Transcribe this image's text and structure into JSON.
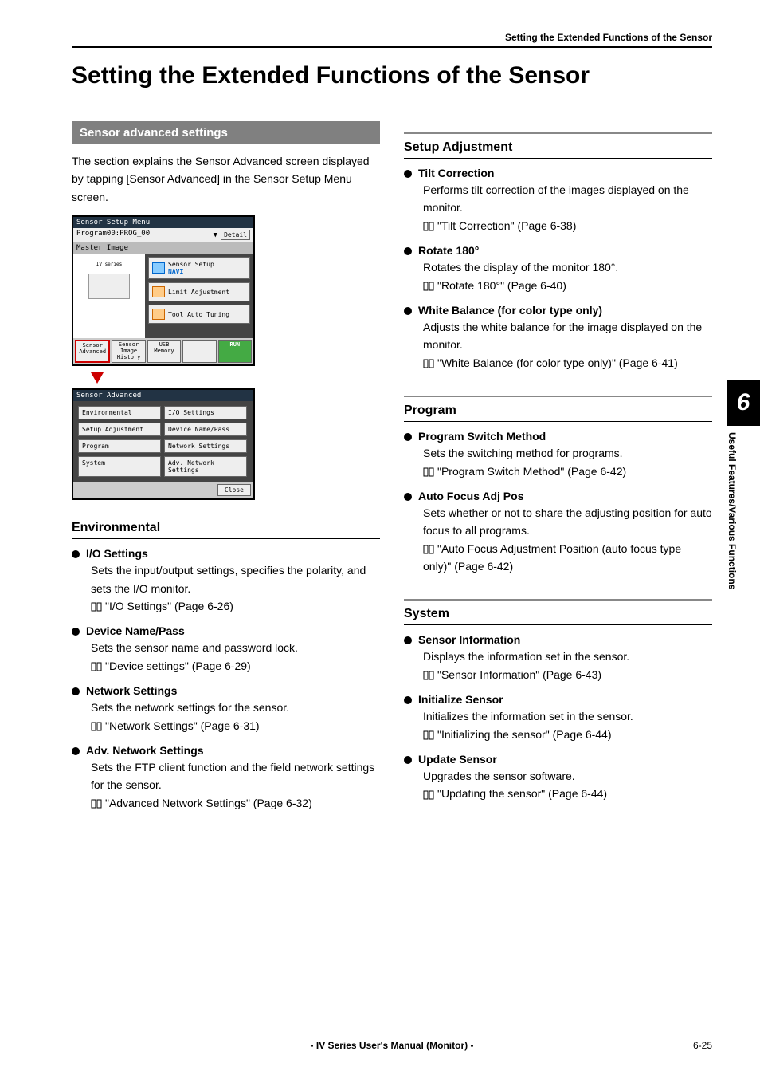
{
  "breadcrumb": "Setting the Extended Functions of the Sensor",
  "title": "Setting the Extended Functions of the Sensor",
  "side_tab": {
    "num": "6",
    "label": "Useful Features/Various Functions"
  },
  "footer": {
    "center": "- IV Series User's Manual (Monitor) -",
    "page": "6-25"
  },
  "left": {
    "section_bar": "Sensor advanced settings",
    "intro": "The section explains the Sensor Advanced screen displayed by tapping [Sensor Advanced] in the Sensor Setup Menu screen.",
    "shot1": {
      "title": "Sensor Setup Menu",
      "program": "Program00:PROG_00",
      "detail": "Detail",
      "master": "Master Image",
      "sensor_setup": "Sensor Setup",
      "navi": "NAVI",
      "limit": "Limit Adjustment",
      "auto": "Tool Auto Tuning",
      "footer": {
        "sensor_adv": "Sensor\nAdvanced",
        "img_hist": "Sensor\nImage\nHistory",
        "usb": "USB\nMemory",
        "run": "RUN"
      }
    },
    "shot2": {
      "title": "Sensor Advanced",
      "buttons": [
        "Environmental",
        "I/O Settings",
        "Setup Adjustment",
        "Device Name/Pass",
        "Program",
        "Network Settings",
        "System",
        "Adv. Network Settings"
      ],
      "close": "Close"
    },
    "env_heading": "Environmental",
    "env_items": [
      {
        "title": "I/O Settings",
        "desc": "Sets the input/output settings, specifies the polarity, and sets the I/O monitor.",
        "ref": "\"I/O Settings\" (Page 6-26)"
      },
      {
        "title": "Device Name/Pass",
        "desc": "Sets the sensor name and password lock.",
        "ref": "\"Device settings\" (Page 6-29)"
      },
      {
        "title": "Network Settings",
        "desc": "Sets the network settings for the sensor.",
        "ref": "\"Network Settings\" (Page 6-31)"
      },
      {
        "title": "Adv. Network Settings",
        "desc": "Sets the FTP client function and the field network settings for the sensor.",
        "ref": "\"Advanced Network Settings\" (Page 6-32)"
      }
    ]
  },
  "right": {
    "setup_heading": "Setup Adjustment",
    "setup_items": [
      {
        "title": "Tilt Correction",
        "desc": "Performs tilt correction of the images displayed on the monitor.",
        "ref": "\"Tilt Correction\" (Page 6-38)"
      },
      {
        "title": "Rotate 180°",
        "desc": "Rotates the display of the monitor 180°.",
        "ref": "\"Rotate 180°\" (Page 6-40)"
      },
      {
        "title": "White Balance (for color type only)",
        "desc": "Adjusts the white balance for the image displayed on the monitor.",
        "ref": "\"White Balance (for color type only)\" (Page 6-41)"
      }
    ],
    "program_heading": "Program",
    "program_items": [
      {
        "title": "Program Switch Method",
        "desc": "Sets the switching method for programs.",
        "ref": "\"Program Switch Method\" (Page 6-42)"
      },
      {
        "title": "Auto Focus Adj Pos",
        "desc": "Sets whether or not to share the adjusting position for auto focus to all programs.",
        "ref": "\"Auto Focus Adjustment Position (auto focus type only)\" (Page 6-42)"
      }
    ],
    "system_heading": "System",
    "system_items": [
      {
        "title": "Sensor Information",
        "desc": "Displays the information set in the sensor.",
        "ref": "\"Sensor Information\" (Page 6-43)"
      },
      {
        "title": "Initialize Sensor",
        "desc": "Initializes the information set in the sensor.",
        "ref": "\"Initializing the sensor\" (Page 6-44)"
      },
      {
        "title": "Update Sensor",
        "desc": "Upgrades the sensor software.",
        "ref": "\"Updating the sensor\" (Page 6-44)"
      }
    ]
  }
}
